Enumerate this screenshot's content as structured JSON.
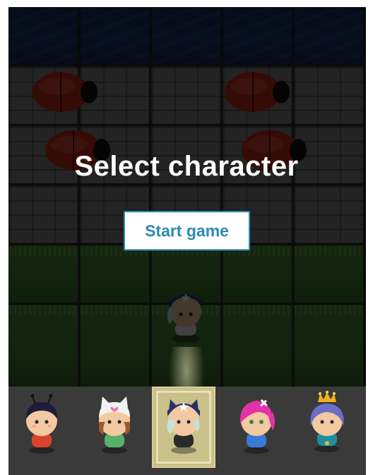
{
  "overlay": {
    "title": "Select character",
    "start_button": "Start game"
  },
  "board": {
    "rows": [
      "water",
      "stone",
      "stone",
      "stone",
      "grass",
      "grass"
    ],
    "columns": 5,
    "enemies": [
      "ladybug",
      "ladybug",
      "ladybug",
      "ladybug"
    ],
    "player_preview": "boy-with-blue-cap"
  },
  "character_bar": {
    "characters": [
      {
        "name": "boy-with-antennae",
        "selected": false
      },
      {
        "name": "girl-with-cat-hat",
        "selected": false
      },
      {
        "name": "boy-with-blue-cap",
        "selected": true
      },
      {
        "name": "girl-with-pink-hair",
        "selected": false
      },
      {
        "name": "princess-with-crown",
        "selected": false
      }
    ]
  },
  "colors": {
    "button_text": "#2c8bb3",
    "button_border": "#2f8fb6",
    "overlay_text": "#ffffff",
    "selected_slot": "#c9c08a"
  }
}
